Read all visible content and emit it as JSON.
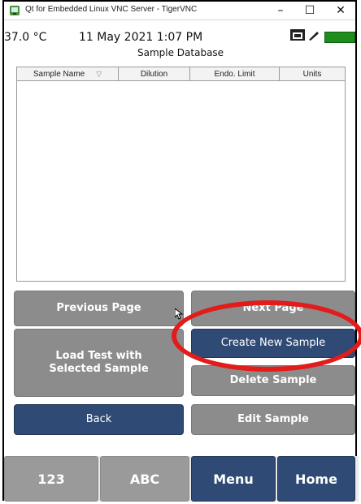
{
  "window": {
    "title": "Qt for Embedded Linux VNC Server - TigerVNC",
    "minimize": "–",
    "maximize": "☐",
    "close": "✕"
  },
  "status": {
    "temperature": "37.0 °C",
    "datetime": "11 May 2021 1:07 PM",
    "screen_title": "Sample Database"
  },
  "table": {
    "columns": [
      "Sample Name",
      "Dilution",
      "Endo. Limit",
      "Units"
    ],
    "rows": []
  },
  "buttons": {
    "previous_page": "Previous Page",
    "next_page": "Next Page",
    "load_test": "Load Test with Selected Sample",
    "create_new_sample": "Create New Sample",
    "delete_sample": "Delete Sample",
    "back": "Back",
    "edit_sample": "Edit Sample"
  },
  "bottom_nav": {
    "num_label": "123",
    "abc_label": "ABC",
    "menu_label": "Menu",
    "home_label": "Home"
  },
  "colors": {
    "navy": "#2f4a74",
    "gray": "#8c8c8c",
    "highlight": "#e21b1b",
    "battery": "#1e8d1e"
  },
  "icons": [
    "vnc-app-icon",
    "folder-icon",
    "wrench-icon",
    "battery-icon",
    "filter-icon",
    "mouse-cursor-icon"
  ]
}
